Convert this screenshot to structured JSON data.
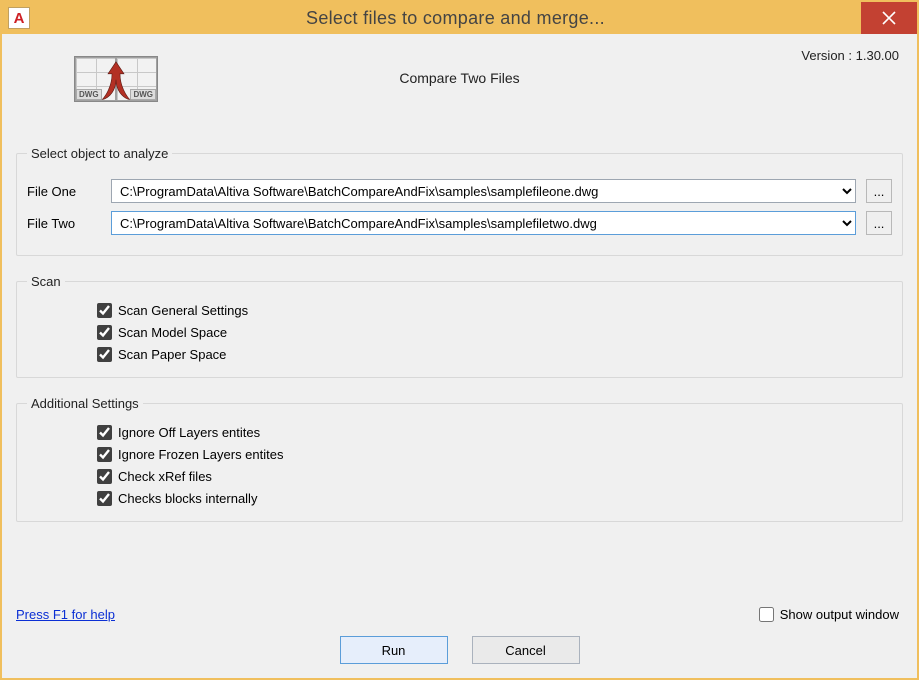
{
  "window": {
    "title": "Select files to compare and merge...",
    "app_badge": "A"
  },
  "header": {
    "title": "Compare Two Files",
    "version_label": "Version : 1.30.00",
    "icon_tag_left": "DWG",
    "icon_tag_right": "DWG"
  },
  "select_group": {
    "legend": "Select object to analyze",
    "file_one_label": "File One",
    "file_one_value": "C:\\ProgramData\\Altiva Software\\BatchCompareAndFix\\samples\\samplefileone.dwg",
    "file_two_label": "File Two",
    "file_two_value": "C:\\ProgramData\\Altiva Software\\BatchCompareAndFix\\samples\\samplefiletwo.dwg",
    "browse_label": "..."
  },
  "scan_group": {
    "legend": "Scan",
    "items": [
      {
        "label": "Scan General Settings",
        "checked": true
      },
      {
        "label": "Scan Model Space",
        "checked": true
      },
      {
        "label": "Scan Paper Space",
        "checked": true
      }
    ]
  },
  "addl_group": {
    "legend": "Additional Settings",
    "items": [
      {
        "label": "Ignore Off Layers entites",
        "checked": true
      },
      {
        "label": "Ignore Frozen Layers entites",
        "checked": true
      },
      {
        "label": "Check xRef files",
        "checked": true
      },
      {
        "label": "Checks blocks internally",
        "checked": true
      }
    ]
  },
  "footer": {
    "help_text": "Press F1 for help",
    "show_output_label": "Show output window",
    "show_output_checked": false,
    "run_label": "Run",
    "cancel_label": "Cancel"
  }
}
